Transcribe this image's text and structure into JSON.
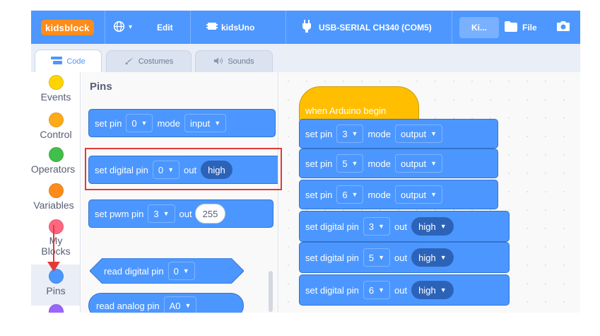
{
  "menu": {
    "logo": "kidsblock",
    "globe_caret": "▾",
    "edit": "Edit",
    "device": "kidsUno",
    "port": "USB-SERIAL CH340 (COM5)",
    "project_short": "Ki...",
    "file": "File"
  },
  "tabs": [
    {
      "label": "Code"
    },
    {
      "label": "Costumes"
    },
    {
      "label": "Sounds"
    }
  ],
  "categories": [
    {
      "label": "Events",
      "color": "#ffd500"
    },
    {
      "label": "Control",
      "color": "#ffab19"
    },
    {
      "label": "Operators",
      "color": "#40bf4a"
    },
    {
      "label": "Variables",
      "color": "#ff8c1a"
    },
    {
      "label": "My\nBlocks",
      "color": "#ff6680"
    },
    {
      "label": "Pins",
      "color": "#4c97ff"
    },
    {
      "label": "",
      "color": "#9966ff"
    }
  ],
  "palette": {
    "title": "Pins",
    "blocks": {
      "set_pin": {
        "t1": "set pin",
        "pin": "0",
        "t2": "mode",
        "mode": "input"
      },
      "set_digital": {
        "t1": "set digital pin",
        "pin": "0",
        "t2": "out",
        "val": "high"
      },
      "set_pwm": {
        "t1": "set pwm pin",
        "pin": "3",
        "t2": "out",
        "val": "255"
      },
      "read_digital": {
        "t1": "read digital pin",
        "pin": "0"
      },
      "read_analog": {
        "t1": "read analog pin",
        "pin": "A0"
      }
    }
  },
  "script": {
    "hat": "when Arduino begin",
    "set_pin_label": "set pin",
    "mode_label": "mode",
    "set_digital_label": "set digital pin",
    "out_label": "out",
    "mode_blocks": [
      {
        "pin": "3",
        "mode": "output"
      },
      {
        "pin": "5",
        "mode": "output"
      },
      {
        "pin": "6",
        "mode": "output"
      }
    ],
    "digital_blocks": [
      {
        "pin": "3",
        "val": "high"
      },
      {
        "pin": "5",
        "val": "high"
      },
      {
        "pin": "6",
        "val": "high"
      }
    ]
  },
  "colors": {
    "menu_bg": "#4d97ff",
    "pins_block": "#4c97ff",
    "hat_block": "#ffbf00",
    "highlight": "#e53935"
  }
}
